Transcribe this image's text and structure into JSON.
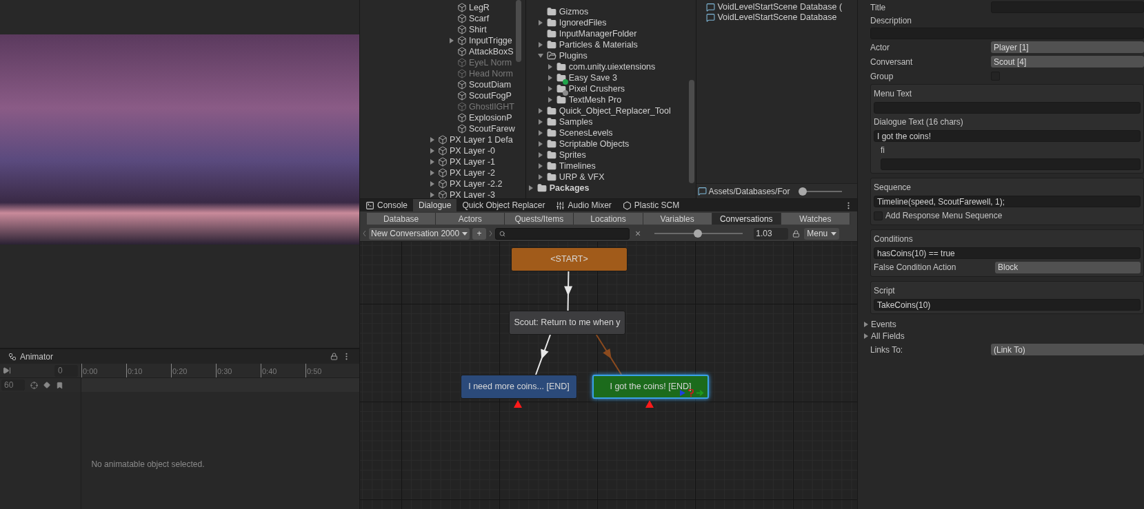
{
  "hierarchy": {
    "inner_items": [
      {
        "label": "LegR",
        "expandable": false,
        "dimmed": false
      },
      {
        "label": "Scarf",
        "expandable": false,
        "dimmed": false
      },
      {
        "label": "Shirt",
        "expandable": false,
        "dimmed": false
      },
      {
        "label": "InputTrigge",
        "expandable": true,
        "dimmed": false
      },
      {
        "label": "AttackBoxS",
        "expandable": false,
        "dimmed": false
      },
      {
        "label": "EyeL Norm",
        "expandable": false,
        "dimmed": true
      },
      {
        "label": "Head Norm",
        "expandable": false,
        "dimmed": true
      },
      {
        "label": "ScoutDiam",
        "expandable": false,
        "dimmed": false
      },
      {
        "label": "ScoutFogP",
        "expandable": false,
        "dimmed": false
      },
      {
        "label": "GhostlIGHT",
        "expandable": false,
        "dimmed": true
      },
      {
        "label": "ExplosionP",
        "expandable": false,
        "dimmed": false
      },
      {
        "label": "ScoutFarew",
        "expandable": false,
        "dimmed": false
      }
    ],
    "outer_items": [
      {
        "label": "PX Layer 1 Defa",
        "expandable": true,
        "dimmed": false
      },
      {
        "label": "PX Layer -0",
        "expandable": true,
        "dimmed": false
      },
      {
        "label": "PX Layer -1",
        "expandable": true,
        "dimmed": false
      },
      {
        "label": "PX Layer -2",
        "expandable": true,
        "dimmed": false
      },
      {
        "label": "PX Layer -2.2",
        "expandable": true,
        "dimmed": false
      },
      {
        "label": "PX Layer -3",
        "expandable": true,
        "dimmed": false
      }
    ]
  },
  "project": {
    "items": [
      {
        "label": "Gizmos",
        "expandable": false
      },
      {
        "label": "IgnoredFiles",
        "expandable": true,
        "expanded": false
      },
      {
        "label": "InputManagerFolder",
        "expandable": false
      },
      {
        "label": "Particles & Materials",
        "expandable": true,
        "expanded": false
      },
      {
        "label": "Plugins",
        "expandable": true,
        "expanded": true,
        "children": [
          {
            "label": "com.unity.uiextensions",
            "expandable": true,
            "expanded": false,
            "added": false,
            "removed": false
          },
          {
            "label": "Easy Save 3",
            "expandable": true,
            "expanded": false,
            "added": true,
            "removed": false
          },
          {
            "label": "Pixel Crushers",
            "expandable": true,
            "expanded": false,
            "added": false,
            "removed": true
          },
          {
            "label": "TextMesh Pro",
            "expandable": true,
            "expanded": false,
            "added": false,
            "removed": false
          }
        ]
      },
      {
        "label": "Quick_Object_Replacer_Tool",
        "expandable": true,
        "expanded": false
      },
      {
        "label": "Samples",
        "expandable": true,
        "expanded": false
      },
      {
        "label": "ScenesLevels",
        "expandable": true,
        "expanded": false
      },
      {
        "label": "Scriptable Objects",
        "expandable": true,
        "expanded": false
      },
      {
        "label": "Sprites",
        "expandable": true,
        "expanded": false
      },
      {
        "label": "Timelines",
        "expandable": true,
        "expanded": false
      },
      {
        "label": "URP & VFX",
        "expandable": true,
        "expanded": false
      }
    ],
    "root_items": [
      {
        "label": "Packages",
        "expandable": true,
        "expanded": false
      }
    ]
  },
  "assets": {
    "files": [
      "VoidLevelStartScene Database (",
      "VoidLevelStartScene Database"
    ],
    "path": "Assets/Databases/For",
    "zoom": {
      "level": 0.05
    }
  },
  "dialogue_window": {
    "tabs": [
      {
        "label": "Console",
        "selected": false
      },
      {
        "label": "Dialogue",
        "selected": true
      },
      {
        "label": "Quick Object Replacer",
        "selected": false
      },
      {
        "label": "Audio Mixer",
        "selected": false
      },
      {
        "label": "Plastic SCM",
        "selected": false
      }
    ],
    "sections": [
      {
        "label": "Database",
        "selected": false
      },
      {
        "label": "Actors",
        "selected": false
      },
      {
        "label": "Quests/Items",
        "selected": false
      },
      {
        "label": "Locations",
        "selected": false
      },
      {
        "label": "Variables",
        "selected": false
      },
      {
        "label": "Conversations",
        "selected": true
      },
      {
        "label": "Watches",
        "selected": false
      }
    ],
    "toolbar": {
      "conversation": "New Conversation 2000",
      "add": "+",
      "clear": "×",
      "zoom": {
        "level": 0.49
      },
      "zoom_value": "1.03",
      "menu": "Menu"
    },
    "nodes": [
      {
        "label": "<START>",
        "color": "#a15b1a",
        "selected": false,
        "end_marker": false,
        "has_sequence": false,
        "has_conditions": false,
        "has_script": false
      },
      {
        "label": "Scout: Return to me when y",
        "color": "#3d3d3f",
        "selected": false,
        "end_marker": false,
        "has_sequence": false,
        "has_conditions": false,
        "has_script": false
      },
      {
        "label": "I need more coins... [END]",
        "color": "#2b4a7a",
        "selected": false,
        "end_marker": true,
        "has_sequence": false,
        "has_conditions": false,
        "has_script": false
      },
      {
        "label": "I got the coins! [END]",
        "color": "#1c6b1c",
        "selected": true,
        "end_marker": true,
        "has_sequence": true,
        "has_conditions": true,
        "has_script": true
      }
    ],
    "links": [
      {
        "color": "#e8e8e8"
      },
      {
        "color": "#e8e8e8"
      },
      {
        "color": "#8b4a1e"
      }
    ]
  },
  "inspector": {
    "title_label": "Title",
    "description_label": "Description",
    "actor_label": "Actor",
    "actor": "Player [1]",
    "conversant_label": "Conversant",
    "conversant": "Scout [4]",
    "group_label": "Group",
    "group_checked": false,
    "menu_text_label": "Menu Text",
    "dialogue_text_label": "Dialogue Text (16 chars)",
    "dialogue_text": "I got the coins!",
    "localized_label": "fi",
    "sequence_label": "Sequence",
    "sequence": "Timeline(speed, ScoutFarewell, 1);",
    "add_response_label": "Add Response Menu Sequence",
    "add_response_checked": false,
    "conditions_label": "Conditions",
    "conditions": "hasCoins(10)  == true",
    "false_action_label": "False Condition Action",
    "false_action": "Block",
    "script_label": "Script",
    "script": "TakeCoins(10)",
    "foldouts": [
      {
        "label": "Events",
        "expanded": false
      },
      {
        "label": "All Fields",
        "expanded": false
      }
    ],
    "links_to_label": "Links To:",
    "links_to": "(Link To)"
  },
  "animator": {
    "title": "Animator",
    "frame": "0",
    "sample_rate": "60",
    "ticks": [
      "0:00",
      "0:10",
      "0:20",
      "0:30",
      "0:40",
      "0:50"
    ],
    "message": "No animatable object selected."
  }
}
